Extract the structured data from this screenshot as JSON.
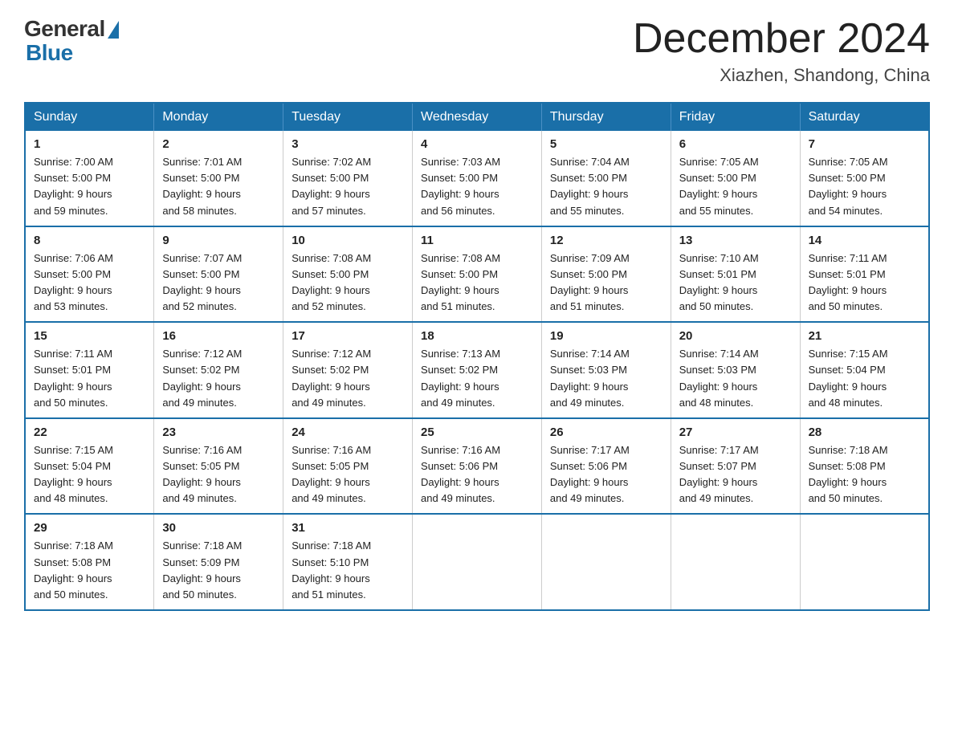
{
  "logo": {
    "general": "General",
    "blue": "Blue"
  },
  "title": "December 2024",
  "location": "Xiazhen, Shandong, China",
  "days_of_week": [
    "Sunday",
    "Monday",
    "Tuesday",
    "Wednesday",
    "Thursday",
    "Friday",
    "Saturday"
  ],
  "weeks": [
    [
      {
        "num": "1",
        "sunrise": "7:00 AM",
        "sunset": "5:00 PM",
        "daylight": "9 hours and 59 minutes."
      },
      {
        "num": "2",
        "sunrise": "7:01 AM",
        "sunset": "5:00 PM",
        "daylight": "9 hours and 58 minutes."
      },
      {
        "num": "3",
        "sunrise": "7:02 AM",
        "sunset": "5:00 PM",
        "daylight": "9 hours and 57 minutes."
      },
      {
        "num": "4",
        "sunrise": "7:03 AM",
        "sunset": "5:00 PM",
        "daylight": "9 hours and 56 minutes."
      },
      {
        "num": "5",
        "sunrise": "7:04 AM",
        "sunset": "5:00 PM",
        "daylight": "9 hours and 55 minutes."
      },
      {
        "num": "6",
        "sunrise": "7:05 AM",
        "sunset": "5:00 PM",
        "daylight": "9 hours and 55 minutes."
      },
      {
        "num": "7",
        "sunrise": "7:05 AM",
        "sunset": "5:00 PM",
        "daylight": "9 hours and 54 minutes."
      }
    ],
    [
      {
        "num": "8",
        "sunrise": "7:06 AM",
        "sunset": "5:00 PM",
        "daylight": "9 hours and 53 minutes."
      },
      {
        "num": "9",
        "sunrise": "7:07 AM",
        "sunset": "5:00 PM",
        "daylight": "9 hours and 52 minutes."
      },
      {
        "num": "10",
        "sunrise": "7:08 AM",
        "sunset": "5:00 PM",
        "daylight": "9 hours and 52 minutes."
      },
      {
        "num": "11",
        "sunrise": "7:08 AM",
        "sunset": "5:00 PM",
        "daylight": "9 hours and 51 minutes."
      },
      {
        "num": "12",
        "sunrise": "7:09 AM",
        "sunset": "5:00 PM",
        "daylight": "9 hours and 51 minutes."
      },
      {
        "num": "13",
        "sunrise": "7:10 AM",
        "sunset": "5:01 PM",
        "daylight": "9 hours and 50 minutes."
      },
      {
        "num": "14",
        "sunrise": "7:11 AM",
        "sunset": "5:01 PM",
        "daylight": "9 hours and 50 minutes."
      }
    ],
    [
      {
        "num": "15",
        "sunrise": "7:11 AM",
        "sunset": "5:01 PM",
        "daylight": "9 hours and 50 minutes."
      },
      {
        "num": "16",
        "sunrise": "7:12 AM",
        "sunset": "5:02 PM",
        "daylight": "9 hours and 49 minutes."
      },
      {
        "num": "17",
        "sunrise": "7:12 AM",
        "sunset": "5:02 PM",
        "daylight": "9 hours and 49 minutes."
      },
      {
        "num": "18",
        "sunrise": "7:13 AM",
        "sunset": "5:02 PM",
        "daylight": "9 hours and 49 minutes."
      },
      {
        "num": "19",
        "sunrise": "7:14 AM",
        "sunset": "5:03 PM",
        "daylight": "9 hours and 49 minutes."
      },
      {
        "num": "20",
        "sunrise": "7:14 AM",
        "sunset": "5:03 PM",
        "daylight": "9 hours and 48 minutes."
      },
      {
        "num": "21",
        "sunrise": "7:15 AM",
        "sunset": "5:04 PM",
        "daylight": "9 hours and 48 minutes."
      }
    ],
    [
      {
        "num": "22",
        "sunrise": "7:15 AM",
        "sunset": "5:04 PM",
        "daylight": "9 hours and 48 minutes."
      },
      {
        "num": "23",
        "sunrise": "7:16 AM",
        "sunset": "5:05 PM",
        "daylight": "9 hours and 49 minutes."
      },
      {
        "num": "24",
        "sunrise": "7:16 AM",
        "sunset": "5:05 PM",
        "daylight": "9 hours and 49 minutes."
      },
      {
        "num": "25",
        "sunrise": "7:16 AM",
        "sunset": "5:06 PM",
        "daylight": "9 hours and 49 minutes."
      },
      {
        "num": "26",
        "sunrise": "7:17 AM",
        "sunset": "5:06 PM",
        "daylight": "9 hours and 49 minutes."
      },
      {
        "num": "27",
        "sunrise": "7:17 AM",
        "sunset": "5:07 PM",
        "daylight": "9 hours and 49 minutes."
      },
      {
        "num": "28",
        "sunrise": "7:18 AM",
        "sunset": "5:08 PM",
        "daylight": "9 hours and 50 minutes."
      }
    ],
    [
      {
        "num": "29",
        "sunrise": "7:18 AM",
        "sunset": "5:08 PM",
        "daylight": "9 hours and 50 minutes."
      },
      {
        "num": "30",
        "sunrise": "7:18 AM",
        "sunset": "5:09 PM",
        "daylight": "9 hours and 50 minutes."
      },
      {
        "num": "31",
        "sunrise": "7:18 AM",
        "sunset": "5:10 PM",
        "daylight": "9 hours and 51 minutes."
      },
      null,
      null,
      null,
      null
    ]
  ]
}
